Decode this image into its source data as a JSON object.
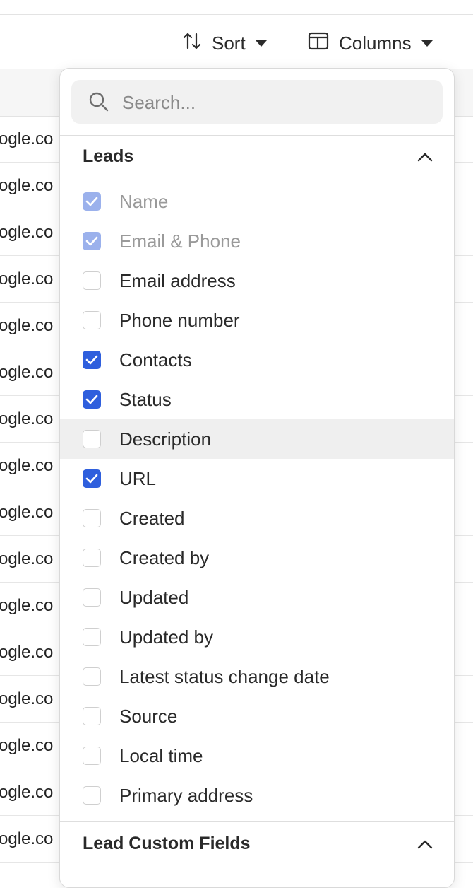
{
  "toolbar": {
    "sort_label": "Sort",
    "columns_label": "Columns"
  },
  "table": {
    "rows": [
      "ogle.co",
      "ogle.co",
      "ogle.co",
      "ogle.co",
      "ogle.co",
      "ogle.co",
      "ogle.co",
      "ogle.co",
      "ogle.co",
      "ogle.co",
      "ogle.co",
      "ogle.co",
      "ogle.co",
      "ogle.co",
      "ogle.co",
      "ogle.co"
    ]
  },
  "columns_menu": {
    "search_placeholder": "Search...",
    "sections": [
      {
        "title": "Leads",
        "expanded": true,
        "options": [
          {
            "label": "Name",
            "checked": true,
            "disabled": true
          },
          {
            "label": "Email & Phone",
            "checked": true,
            "disabled": true
          },
          {
            "label": "Email address",
            "checked": false
          },
          {
            "label": "Phone number",
            "checked": false
          },
          {
            "label": "Contacts",
            "checked": true
          },
          {
            "label": "Status",
            "checked": true
          },
          {
            "label": "Description",
            "checked": false,
            "hovered": true
          },
          {
            "label": "URL",
            "checked": true
          },
          {
            "label": "Created",
            "checked": false
          },
          {
            "label": "Created by",
            "checked": false
          },
          {
            "label": "Updated",
            "checked": false
          },
          {
            "label": "Updated by",
            "checked": false
          },
          {
            "label": "Latest status change date",
            "checked": false
          },
          {
            "label": "Source",
            "checked": false
          },
          {
            "label": "Local time",
            "checked": false
          },
          {
            "label": "Primary address",
            "checked": false
          }
        ]
      },
      {
        "title": "Lead Custom Fields",
        "expanded": true,
        "options": []
      }
    ]
  },
  "colors": {
    "accent": "#2f5fdd",
    "accent_disabled": "#9bb1ec",
    "hover_row": "#efefef"
  }
}
